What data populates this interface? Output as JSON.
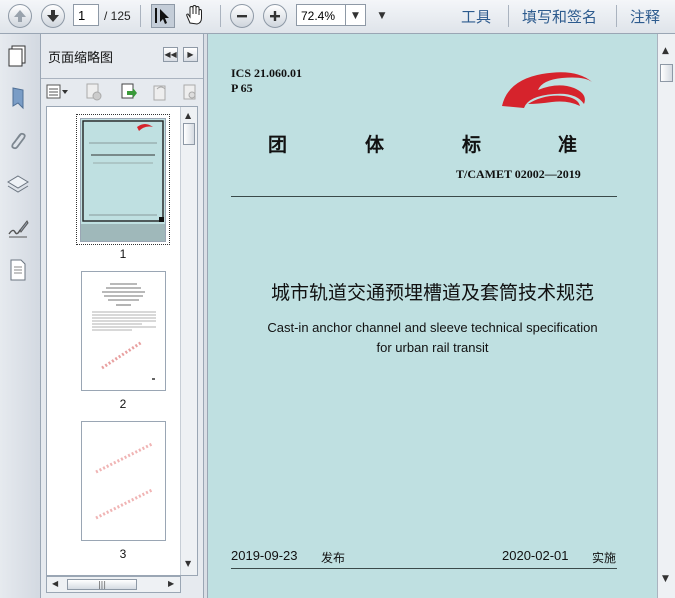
{
  "toolbar": {
    "page_current": "1",
    "page_total": "/ 125",
    "zoom": "72.4%",
    "tools_label": "工具",
    "sign_label": "填写和签名",
    "comment_label": "注释"
  },
  "thumbnail_panel": {
    "title": "页面缩略图",
    "pages": [
      {
        "number": "1"
      },
      {
        "number": "2"
      },
      {
        "number": "3"
      }
    ],
    "hscroll_grip": "|||"
  },
  "document": {
    "ics": "ICS  21.060.01",
    "p_code": "P  65",
    "std_chars": [
      "团",
      "体",
      "标",
      "准"
    ],
    "std_number": "T/CAMET  02002—2019",
    "title_cn": "城市轨道交通预埋槽道及套筒技术规范",
    "title_en_line1": "Cast-in anchor channel and sleeve technical specification",
    "title_en_line2": "for urban rail transit",
    "publish_date": "2019-09-23",
    "publish_label": "发布",
    "implement_date": "2020-02-01",
    "implement_label": "实施"
  },
  "colors": {
    "page_background": "#bfe0e1",
    "logo_red": "#d6232c",
    "toolbar_link": "#2d5b8e"
  }
}
